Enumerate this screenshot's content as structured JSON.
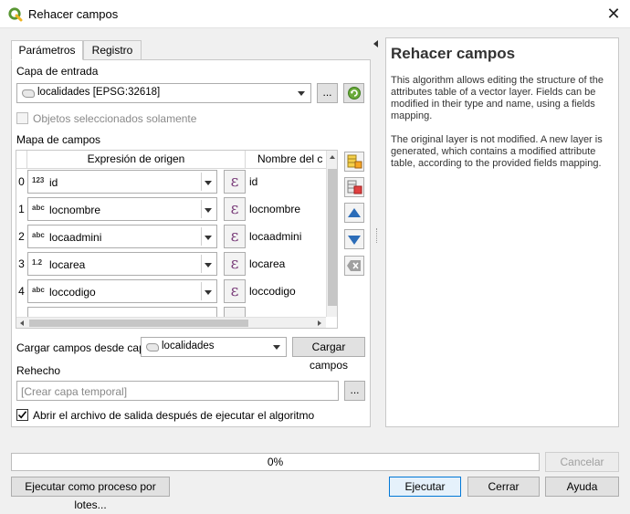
{
  "window": {
    "title": "Rehacer campos"
  },
  "tabs": [
    {
      "label": "Parámetros"
    },
    {
      "label": "Registro"
    }
  ],
  "input_layer": {
    "label": "Capa de entrada",
    "value": "localidades [EPSG:32618]",
    "browse_label": "..."
  },
  "selected_only": {
    "label": "Objetos seleccionados solamente",
    "checked": false,
    "enabled": false
  },
  "field_map": {
    "label": "Mapa de campos",
    "headers": {
      "expression": "Expresión de origen",
      "name": "Nombre del c"
    },
    "rows": [
      {
        "index": "0",
        "type_icon": "123",
        "expression": "id",
        "name": "id"
      },
      {
        "index": "1",
        "type_icon": "abc",
        "expression": "locnombre",
        "name": "locnombre"
      },
      {
        "index": "2",
        "type_icon": "abc",
        "expression": "locaadmini",
        "name": "locaadmini"
      },
      {
        "index": "3",
        "type_icon": "1.2",
        "expression": "locarea",
        "name": "locarea"
      },
      {
        "index": "4",
        "type_icon": "abc",
        "expression": "loccodigo",
        "name": "loccodigo"
      }
    ]
  },
  "load_fields": {
    "label": "Cargar campos desde capa",
    "layer": "localidades",
    "button_label": "Cargar campos"
  },
  "output": {
    "label": "Rehecho",
    "placeholder": "[Crear capa temporal]",
    "browse_label": "..."
  },
  "open_output": {
    "label": "Abrir el archivo de salida después de ejecutar el algoritmo",
    "checked": true
  },
  "help": {
    "title": "Rehacer campos",
    "paragraph1": "This algorithm allows editing the structure of the attributes table of a vector layer. Fields can be modified in their type and name, using a fields mapping.",
    "paragraph2": "The original layer is not modified. A new layer is generated, which contains a modified attribute table, according to the provided fields mapping."
  },
  "progress": {
    "value": 0,
    "text": "0%"
  },
  "buttons": {
    "cancel": "Cancelar",
    "batch": "Ejecutar como proceso por lotes...",
    "run": "Ejecutar",
    "close": "Cerrar",
    "help": "Ayuda"
  },
  "colors": {
    "accent": "#0078d7",
    "expression_icon": "#7a3d7a",
    "qgis_green": "#589632"
  }
}
